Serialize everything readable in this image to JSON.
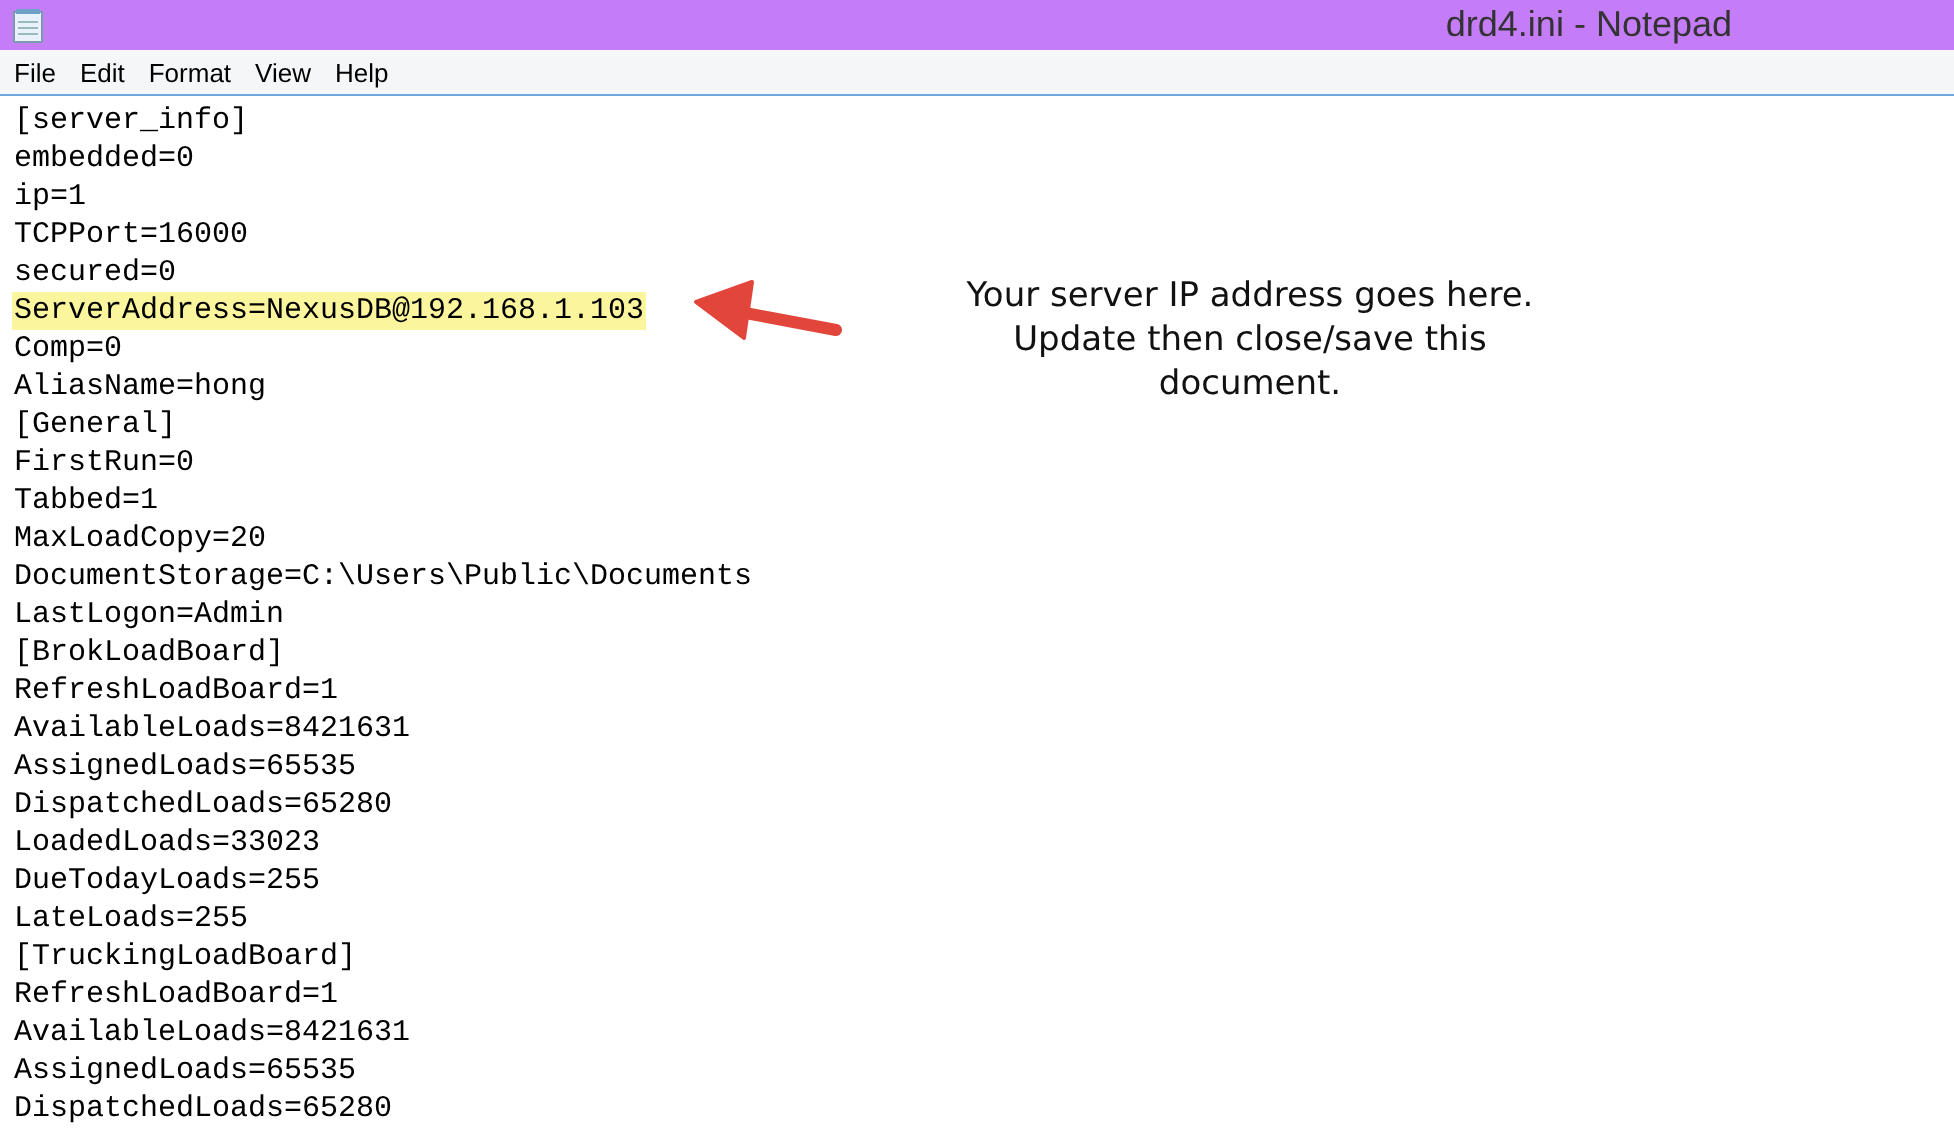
{
  "window": {
    "title": "drd4.ini - Notepad"
  },
  "menu": [
    "File",
    "Edit",
    "Format",
    "View",
    "Help"
  ],
  "lines": [
    {
      "text": "[server_info]",
      "highlighted": false
    },
    {
      "text": "embedded=0",
      "highlighted": false
    },
    {
      "text": "ip=1",
      "highlighted": false
    },
    {
      "text": "TCPPort=16000",
      "highlighted": false
    },
    {
      "text": "secured=0",
      "highlighted": false
    },
    {
      "text": "ServerAddress=NexusDB@192.168.1.103",
      "highlighted": true
    },
    {
      "text": "Comp=0",
      "highlighted": false
    },
    {
      "text": "AliasName=hong",
      "highlighted": false
    },
    {
      "text": "[General]",
      "highlighted": false
    },
    {
      "text": "FirstRun=0",
      "highlighted": false
    },
    {
      "text": "Tabbed=1",
      "highlighted": false
    },
    {
      "text": "MaxLoadCopy=20",
      "highlighted": false
    },
    {
      "text": "DocumentStorage=C:\\Users\\Public\\Documents",
      "highlighted": false
    },
    {
      "text": "LastLogon=Admin",
      "highlighted": false
    },
    {
      "text": "[BrokLoadBoard]",
      "highlighted": false
    },
    {
      "text": "RefreshLoadBoard=1",
      "highlighted": false
    },
    {
      "text": "AvailableLoads=8421631",
      "highlighted": false
    },
    {
      "text": "AssignedLoads=65535",
      "highlighted": false
    },
    {
      "text": "DispatchedLoads=65280",
      "highlighted": false
    },
    {
      "text": "LoadedLoads=33023",
      "highlighted": false
    },
    {
      "text": "DueTodayLoads=255",
      "highlighted": false
    },
    {
      "text": "LateLoads=255",
      "highlighted": false
    },
    {
      "text": "[TruckingLoadBoard]",
      "highlighted": false
    },
    {
      "text": "RefreshLoadBoard=1",
      "highlighted": false
    },
    {
      "text": "AvailableLoads=8421631",
      "highlighted": false
    },
    {
      "text": "AssignedLoads=65535",
      "highlighted": false
    },
    {
      "text": "DispatchedLoads=65280",
      "highlighted": false
    }
  ],
  "annotation": {
    "text": "Your server IP address goes here. Update then close/save this document."
  }
}
